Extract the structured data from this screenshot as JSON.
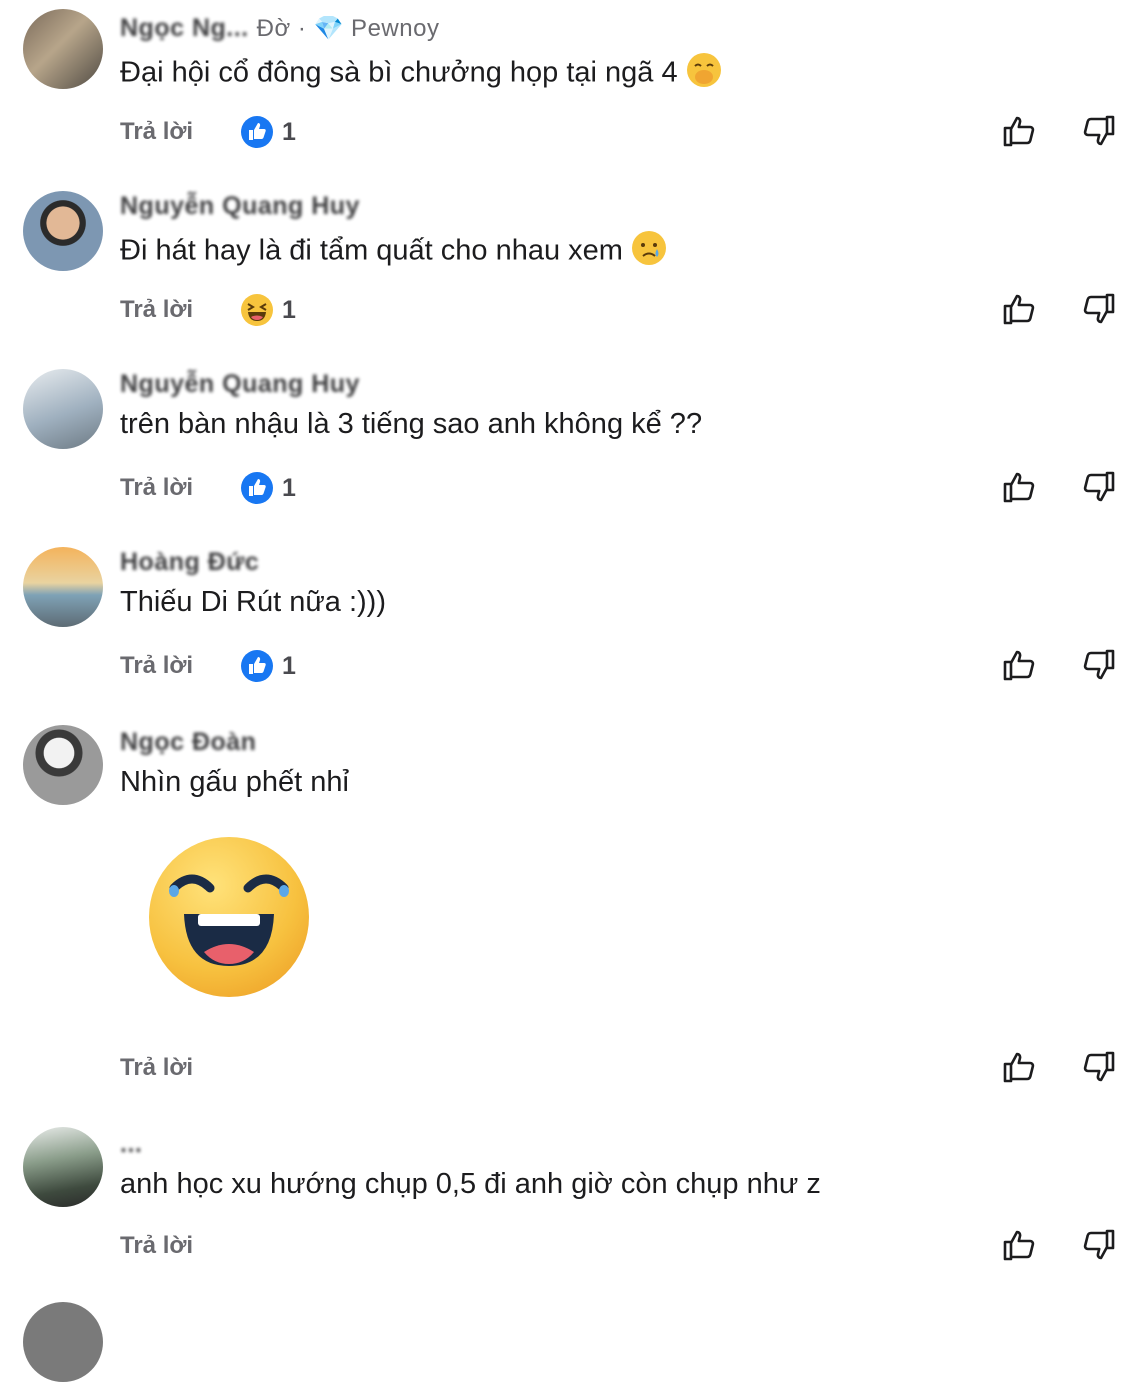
{
  "reply_label": "Trả lời",
  "comments": [
    {
      "name": "Ngọc Ng...",
      "meta": "Đờ · 💎 Pewnoy",
      "text": "Đại hội cổ đông sà bì chưởng họp tại ngã 4",
      "text_emoji": "face-with-hand-over-mouth",
      "reaction": "like",
      "reaction_count": "1"
    },
    {
      "name": "Nguyễn Quang Huy",
      "text": "Đi hát hay là đi tẩm quất cho nhau xem",
      "text_emoji": "crying-face",
      "reaction": "haha",
      "reaction_count": "1"
    },
    {
      "name": "Nguyễn Quang Huy",
      "text": "trên bàn nhậu là 3 tiếng sao anh không kể ??",
      "reaction": "like",
      "reaction_count": "1"
    },
    {
      "name": "Hoàng Đức",
      "text": "Thiếu Di Rút nữa :)))",
      "reaction": "like",
      "reaction_count": "1"
    },
    {
      "name": "Ngọc Đoàn",
      "text": "Nhìn gấu phết nhỉ",
      "sticker": "laughing-tears-emoji"
    },
    {
      "name": "...",
      "text": "anh học xu hướng chụp 0,5 đi anh giờ còn chụp như z"
    }
  ],
  "colors": {
    "like_blue": "#1877f2",
    "text": "#1c1c1e",
    "muted": "#6a6a6f"
  }
}
